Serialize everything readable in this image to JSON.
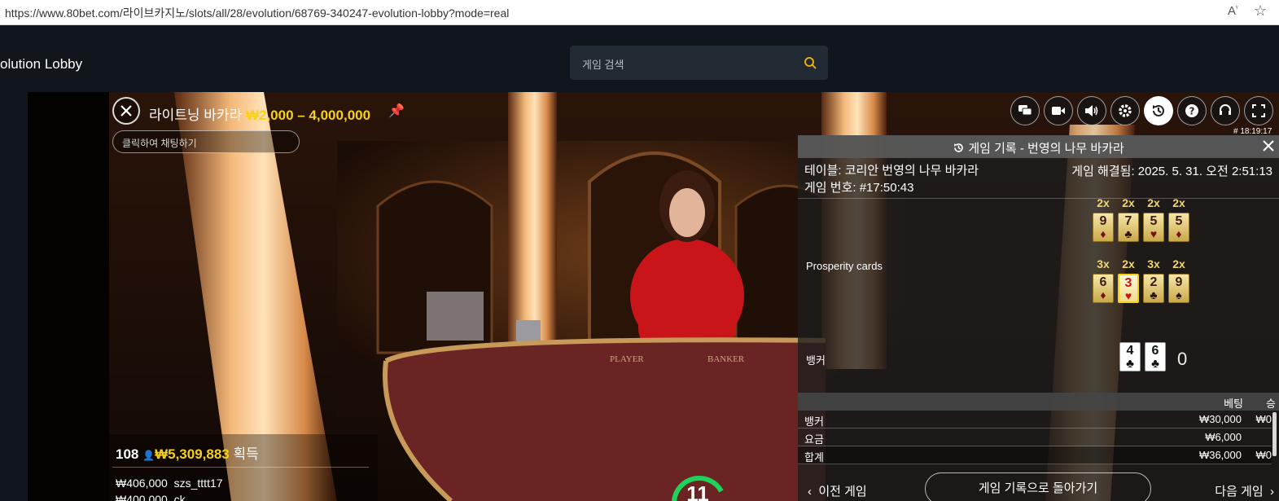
{
  "browser": {
    "url": "https://www.80bet.com/라이브카지노/slots/all/28/evolution/68769-340247-evolution-lobby?mode=real"
  },
  "site": {
    "title": "olution Lobby",
    "search_placeholder": "게임 검색"
  },
  "game": {
    "name": "라이트닝 바카라",
    "limits": "₩2,000 – 4,000,000",
    "chat_placeholder": "클릭하여 채팅하기",
    "clock": "# 18:19:17",
    "winners": {
      "count": "108",
      "amount": "₩5,309,883",
      "label": "획득"
    },
    "recent_wins": [
      {
        "amount": "₩406,000",
        "user": "szs_tttt17"
      },
      {
        "amount": "₩400,000",
        "user": "ck"
      }
    ],
    "timer": "11"
  },
  "toolbar": {
    "icons": [
      "chat-icon",
      "video-icon",
      "volume-icon",
      "settings-icon",
      "history-icon",
      "help-icon",
      "headset-icon",
      "fullscreen-icon"
    ],
    "active": "history-icon"
  },
  "history": {
    "title": "게임 기록 - 번영의 나무 바카라",
    "table": "테이블: 코리안 번영의 나무 바카라",
    "round": "게임 번호: #17:50:43",
    "resolved": "게임 해결됨: 2025. 5. 31. 오전 2:51:13",
    "prosperity_label": "Prosperity cards",
    "prosperity_row1": [
      {
        "mult": "2x",
        "rank": "9",
        "suit": "♦",
        "highlight": false
      },
      {
        "mult": "2x",
        "rank": "7",
        "suit": "♣",
        "highlight": false
      },
      {
        "mult": "2x",
        "rank": "5",
        "suit": "♥",
        "highlight": false
      },
      {
        "mult": "2x",
        "rank": "5",
        "suit": "♦",
        "highlight": false
      }
    ],
    "prosperity_row2": [
      {
        "mult": "3x",
        "rank": "6",
        "suit": "♦",
        "highlight": false
      },
      {
        "mult": "2x",
        "rank": "3",
        "suit": "♥",
        "highlight": true
      },
      {
        "mult": "3x",
        "rank": "2",
        "suit": "♣",
        "highlight": false
      },
      {
        "mult": "2x",
        "rank": "9",
        "suit": "♠",
        "highlight": false
      }
    ],
    "banker_label": "뱅커",
    "banker_cards": [
      {
        "rank": "4",
        "suit": "♣"
      },
      {
        "rank": "6",
        "suit": "♣"
      }
    ],
    "banker_score": "0",
    "bet_headers": {
      "bet": "베팅",
      "win": "승"
    },
    "bets": [
      {
        "name": "뱅커",
        "bet": "₩30,000",
        "win": "₩0"
      },
      {
        "name": "요금",
        "bet": "₩6,000",
        "win": ""
      },
      {
        "name": "합계",
        "bet": "₩36,000",
        "win": "₩0"
      }
    ],
    "prev_label": "이전 게임",
    "back_label": "게임 기록으로 돌아가기",
    "next_label": "다음 게임"
  },
  "colors": {
    "accent": "#f7d117",
    "search_icon": "#f5b800",
    "timer": "#1fd35a"
  }
}
